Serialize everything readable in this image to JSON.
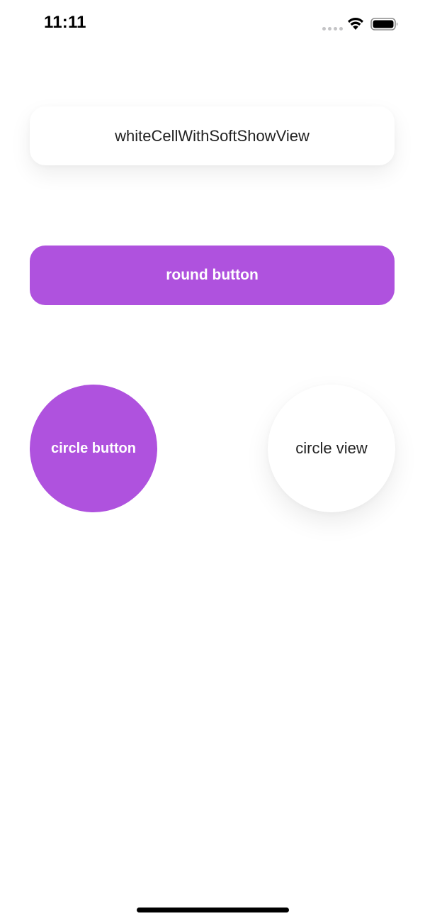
{
  "status_bar": {
    "time": "11:11",
    "icons": [
      "signal-dots-icon",
      "wifi-icon",
      "battery-icon"
    ]
  },
  "white_cell": {
    "label": "whiteCellWithSoftShowView"
  },
  "round_button": {
    "label": "round button"
  },
  "circle_button": {
    "label": "circle button"
  },
  "circle_view": {
    "label": "circle view"
  },
  "colors": {
    "accent": "#af52de",
    "background": "#ffffff",
    "text": "#222222"
  }
}
